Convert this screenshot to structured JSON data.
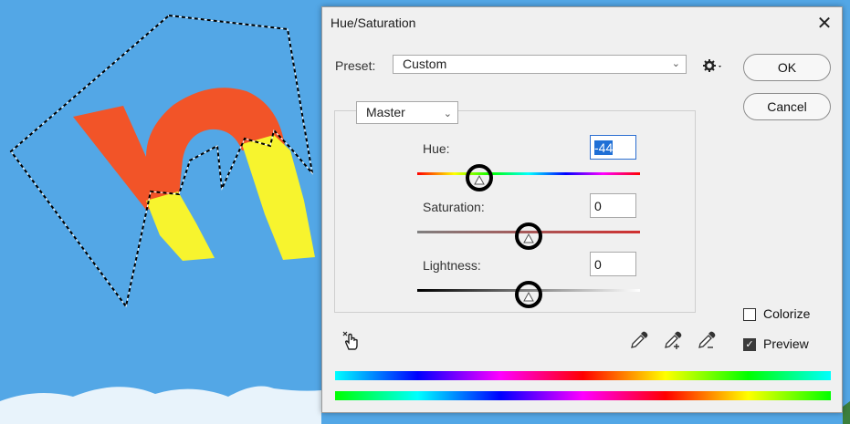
{
  "dialog": {
    "title": "Hue/Saturation",
    "close_glyph": "✕",
    "preset_label": "Preset:",
    "preset_value": "Custom",
    "channel_value": "Master",
    "ok_label": "OK",
    "cancel_label": "Cancel",
    "hue": {
      "label": "Hue:",
      "value": "-44",
      "fraction": 0.28
    },
    "saturation": {
      "label": "Saturation:",
      "value": "0",
      "fraction": 0.5
    },
    "lightness": {
      "label": "Lightness:",
      "value": "0",
      "fraction": 0.5
    },
    "colorize": {
      "label": "Colorize",
      "checked": false
    },
    "preview": {
      "label": "Preview",
      "checked": true
    }
  },
  "icons": {
    "settings": "gear-icon",
    "hand": "targeted-adjustment-hand-icon",
    "eyedropper": "eyedropper-icon",
    "eyedropper_add": "eyedropper-add-icon",
    "eyedropper_subtract": "eyedropper-subtract-icon"
  },
  "colors": {
    "background_sky": "#53a7e6",
    "shape_orange": "#f25428",
    "shape_yellow": "#f7f42e",
    "focus_blue": "#1f6fd6"
  }
}
